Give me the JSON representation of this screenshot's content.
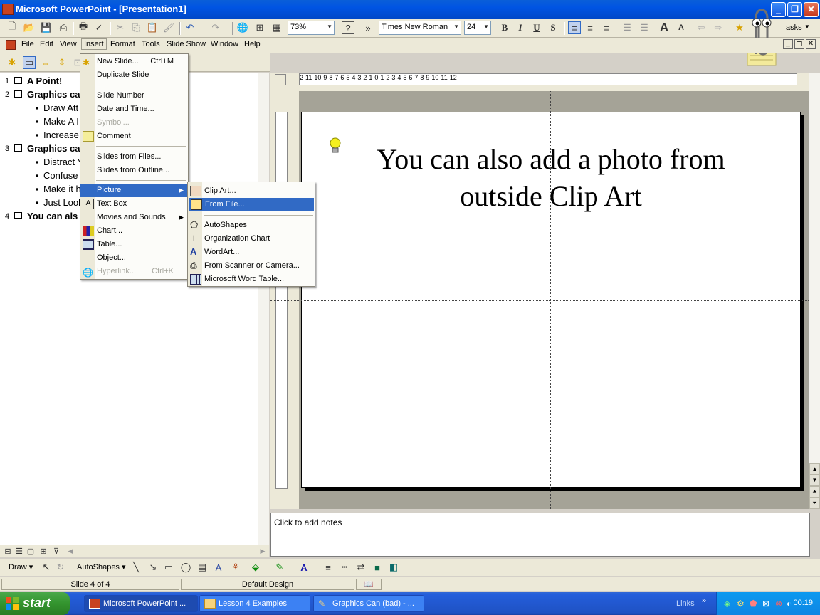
{
  "window": {
    "title": "Microsoft PowerPoint - [Presentation1]",
    "min": "_",
    "max": "❐",
    "close": "✕"
  },
  "toolbar": {
    "zoom": "73%",
    "font": "Times New Roman",
    "font_size": "24",
    "bold": "B",
    "italic": "I",
    "underline": "U",
    "shadow": "S",
    "tasks_label": "asks"
  },
  "menubar": {
    "items": [
      "File",
      "Edit",
      "View",
      "Insert",
      "Format",
      "Tools",
      "Slide Show",
      "Window",
      "Help"
    ]
  },
  "outline": {
    "rows": [
      {
        "num": "1",
        "text": "A Point!"
      },
      {
        "num": "2",
        "text": "Graphics ca"
      },
      {
        "num": "",
        "text": "Draw Att"
      },
      {
        "num": "",
        "text": "Make A I"
      },
      {
        "num": "",
        "text": "Increase"
      },
      {
        "num": "3",
        "text": "Graphics ca"
      },
      {
        "num": "",
        "text": "Distract Y"
      },
      {
        "num": "",
        "text": "Confuse"
      },
      {
        "num": "",
        "text": "Make it h"
      },
      {
        "num": "",
        "text": "Just Lool"
      },
      {
        "num": "4",
        "text": "You can als"
      }
    ]
  },
  "insert_menu": {
    "items": [
      {
        "label": "New Slide...",
        "shortcut": "Ctrl+M",
        "enabled": true,
        "icon": "new-slide-icon"
      },
      {
        "label": "Duplicate Slide",
        "shortcut": "",
        "enabled": true
      },
      {
        "label": "Slide Number",
        "shortcut": "",
        "enabled": true
      },
      {
        "label": "Date and Time...",
        "shortcut": "",
        "enabled": true
      },
      {
        "label": "Symbol...",
        "shortcut": "",
        "enabled": false
      },
      {
        "label": "Comment",
        "shortcut": "",
        "enabled": true,
        "icon": "comment-icon"
      },
      {
        "label": "Slides from Files...",
        "shortcut": "",
        "enabled": true
      },
      {
        "label": "Slides from Outline...",
        "shortcut": "",
        "enabled": true
      },
      {
        "label": "Picture",
        "shortcut": "",
        "enabled": true,
        "submenu": true
      },
      {
        "label": "Text Box",
        "shortcut": "",
        "enabled": true,
        "icon": "text-box-icon"
      },
      {
        "label": "Movies and Sounds",
        "shortcut": "",
        "enabled": true,
        "submenu": true
      },
      {
        "label": "Chart...",
        "shortcut": "",
        "enabled": true,
        "icon": "chart-icon"
      },
      {
        "label": "Table...",
        "shortcut": "",
        "enabled": true,
        "icon": "table-icon"
      },
      {
        "label": "Object...",
        "shortcut": "",
        "enabled": true
      },
      {
        "label": "Hyperlink...",
        "shortcut": "Ctrl+K",
        "enabled": false,
        "icon": "hyperlink-icon"
      }
    ]
  },
  "picture_submenu": {
    "items": [
      {
        "label": "Clip Art...",
        "icon": "clip-art-icon"
      },
      {
        "label": "From File...",
        "icon": "from-file-icon"
      },
      {
        "label": "AutoShapes",
        "icon": "autoshapes-icon"
      },
      {
        "label": "Organization Chart",
        "icon": "org-chart-icon"
      },
      {
        "label": "WordArt...",
        "icon": "wordart-icon"
      },
      {
        "label": "From Scanner or Camera...",
        "icon": "scanner-icon"
      },
      {
        "label": "Microsoft Word Table...",
        "icon": "word-table-icon"
      }
    ]
  },
  "slide": {
    "title_line1": "You can also add a photo from",
    "title_line2": "outside Clip Art"
  },
  "ruler": {
    "h_ticks": "2·11·10·9·8·7·6·5·4·3·2·1·0·1·2·3·4·5·6·7·8·9·10·11·12"
  },
  "notes": {
    "placeholder": "Click to add notes"
  },
  "drawbar": {
    "draw": "Draw ▾",
    "autoshapes": "AutoShapes ▾"
  },
  "status": {
    "slide": "Slide 4 of 4",
    "design": "Default Design"
  },
  "taskbar": {
    "start": "start",
    "tasks": [
      "Microsoft PowerPoint ...",
      "Lesson 4 Examples",
      "Graphics Can (bad) - ..."
    ],
    "links": "Links",
    "clock": "00:19"
  },
  "colors": {
    "highlight": "#316ac5",
    "titlebar": "#0054e3",
    "taskbar": "#245edb",
    "start": "#33942e"
  }
}
